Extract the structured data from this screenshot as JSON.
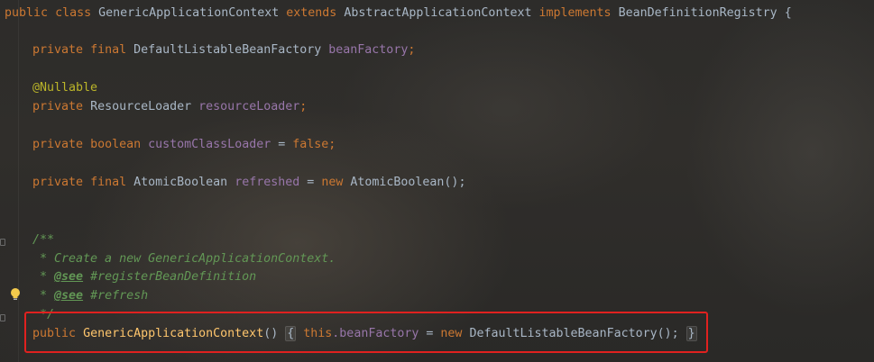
{
  "code": {
    "class_decl": {
      "kw_public": "public",
      "kw_class": "class",
      "class_name": "GenericApplicationContext",
      "kw_extends": "extends",
      "parent": "AbstractApplicationContext",
      "kw_implements": "implements",
      "iface": "BeanDefinitionRegistry",
      "brace": "{"
    },
    "field_bean_factory": {
      "kw_private": "private",
      "kw_final": "final",
      "type": "DefaultListableBeanFactory",
      "name": "beanFactory",
      "semi": ";"
    },
    "annotation_nullable": "@Nullable",
    "field_resource_loader": {
      "kw_private": "private",
      "type": "ResourceLoader",
      "name": "resourceLoader",
      "semi": ";"
    },
    "field_custom_class_loader": {
      "kw_private": "private",
      "kw_type": "boolean",
      "name": "customClassLoader",
      "eq": "=",
      "value": "false",
      "semi": ";"
    },
    "field_refreshed": {
      "kw_private": "private",
      "kw_final": "final",
      "type": "AtomicBoolean",
      "name": "refreshed",
      "eq": "=",
      "kw_new": "new",
      "ctor": "AtomicBoolean();"
    },
    "javadoc": {
      "open": "/**",
      "line1": " * Create a new GenericApplicationContext.",
      "line2_prefix": " * ",
      "line2_tag": "@see",
      "line2_ref": " #registerBeanDefinition",
      "line3_prefix": " * ",
      "line3_tag": "@see",
      "line3_ref": " #refresh",
      "close": " */"
    },
    "constructor": {
      "kw_public": "public",
      "name": "GenericApplicationContext",
      "parens": "()",
      "open_brace": "{",
      "kw_this": "this",
      "dot_field": ".beanFactory",
      "eq": "=",
      "kw_new": "new",
      "ctor": "DefaultListableBeanFactory();",
      "close_brace": "}"
    }
  },
  "colors": {
    "keyword": "#cc7832",
    "field": "#9876aa",
    "annotation": "#bbb529",
    "comment": "#629755",
    "method": "#ffc66d",
    "text": "#a9b7c6",
    "highlight_border": "#e0211f"
  },
  "icons": {
    "intention": "lightbulb-icon",
    "fold": "fold-marker-icon"
  }
}
